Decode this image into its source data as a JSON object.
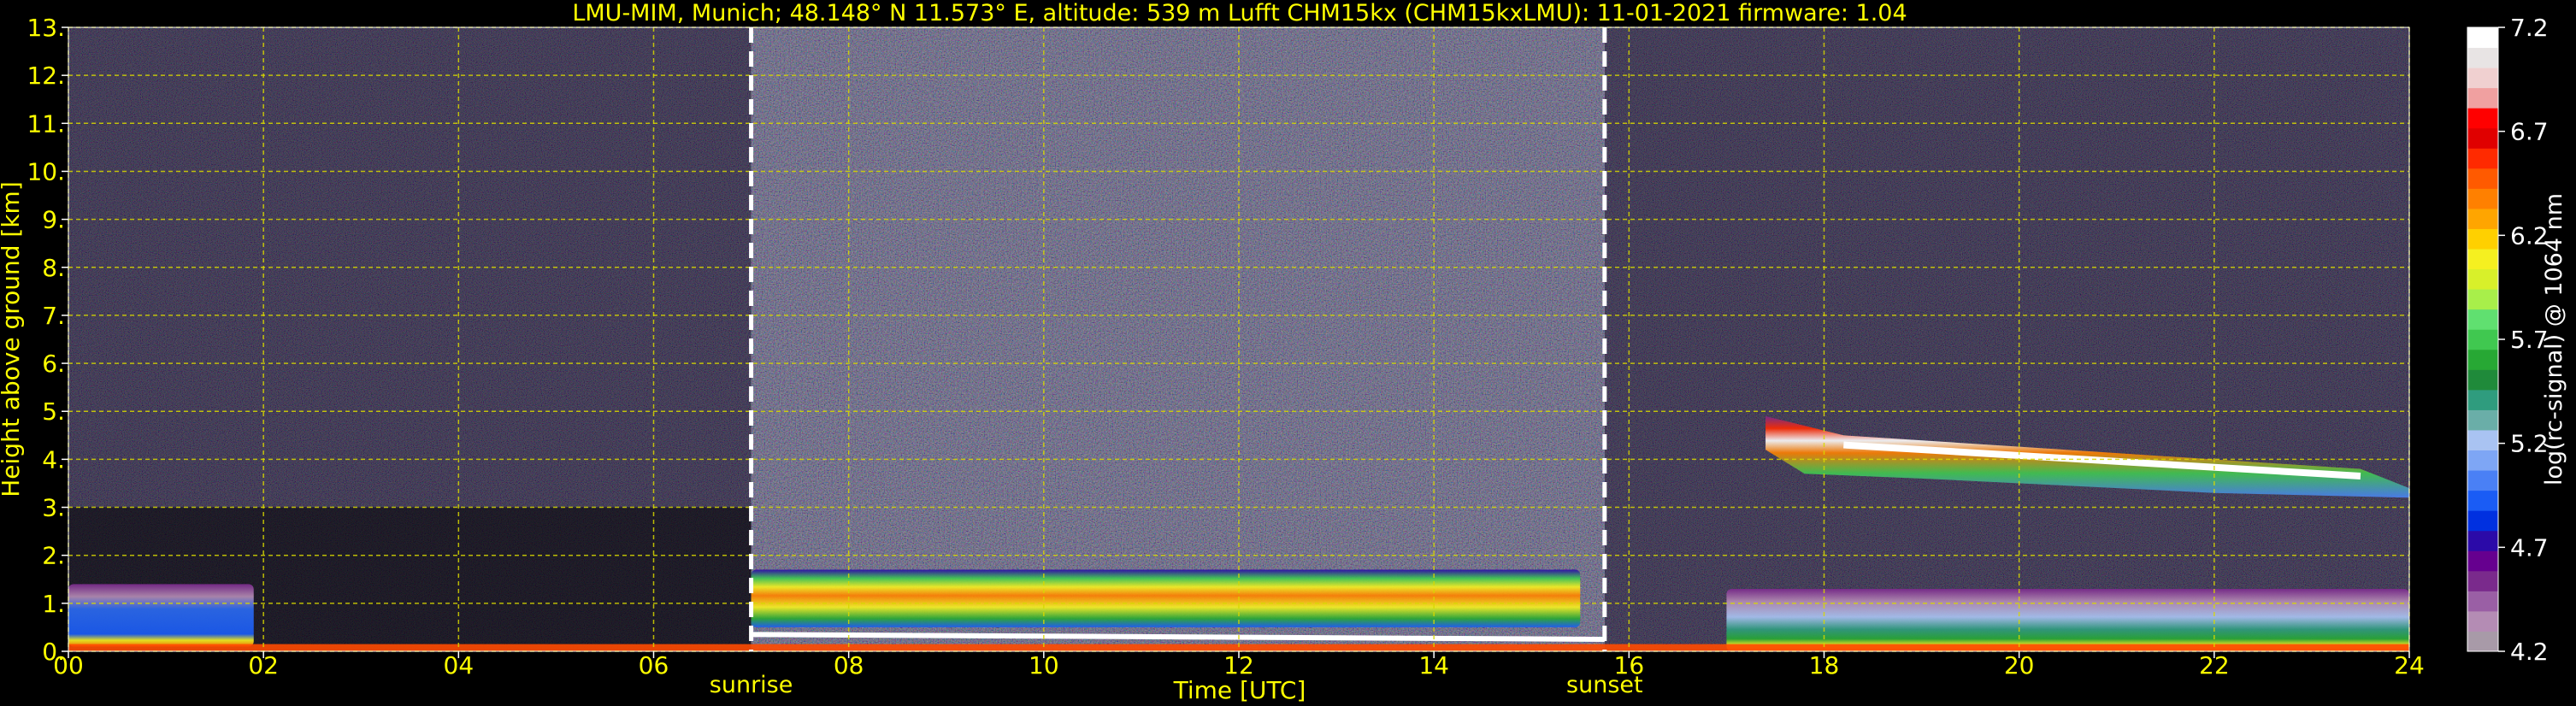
{
  "chart_data": {
    "type": "heatmap",
    "title": "LMU-MIM, Munich; 48.148° N 11.573° E, altitude: 539 m    Lufft CHM15kx (CHM15kxLMU): 11-01-2021    firmware: 1.04",
    "xlabel": "Time [UTC]",
    "ylabel": "Height above ground [km]",
    "xlim": [
      0,
      24
    ],
    "ylim": [
      0,
      13
    ],
    "x_ticks": [
      "00",
      "02",
      "04",
      "06",
      "08",
      "10",
      "12",
      "14",
      "16",
      "18",
      "20",
      "22",
      "24"
    ],
    "y_ticks": [
      "0.",
      "1.",
      "2.",
      "3.",
      "4.",
      "5.",
      "6.",
      "7.",
      "8.",
      "9.",
      "10.",
      "11.",
      "12.",
      "13."
    ],
    "grid": true,
    "colorbar": {
      "label": "log(rc-signal) @ 1064 nm",
      "range": [
        4.2,
        7.2
      ],
      "ticks": [
        "4.2",
        "4.7",
        "5.2",
        "5.7",
        "6.2",
        "6.7",
        "7.2"
      ],
      "colors": [
        "#a89aa8",
        "#b48cb4",
        "#9a5fa5",
        "#7a2a8c",
        "#66008f",
        "#2b0aa8",
        "#0030e0",
        "#1a5cf5",
        "#4a80f5",
        "#7ea6f5",
        "#a9c3f2",
        "#6aaea8",
        "#2f9c7e",
        "#1f8a3a",
        "#27a834",
        "#40c850",
        "#60e070",
        "#a8ef4a",
        "#d8f02a",
        "#f5f020",
        "#ffd000",
        "#ffa500",
        "#ff8000",
        "#ff5a00",
        "#ff2a00",
        "#e00000",
        "#ff0000",
        "#f0a0a0",
        "#f0d0d0",
        "#e8e4e4",
        "#ffffff"
      ]
    },
    "annotations": [
      {
        "label": "sunrise",
        "time": 7.0
      },
      {
        "label": "sunset",
        "time": 15.75
      }
    ],
    "features": [
      {
        "kind": "boundary layer aerosol",
        "start": 7.0,
        "end": 15.5,
        "bottom_km": 0.5,
        "top_km": 1.7
      },
      {
        "kind": "morning aerosol layer",
        "start": 0.0,
        "end": 1.9,
        "bottom_km": 0.1,
        "top_km": 1.4
      },
      {
        "kind": "cloud layer",
        "start": 17.4,
        "end": 24.0,
        "bottom_km": 3.2,
        "top_km": 4.9
      },
      {
        "kind": "evening aerosol layer",
        "start": 17.0,
        "end": 24.0,
        "bottom_km": 0.0,
        "top_km": 1.3
      }
    ]
  }
}
